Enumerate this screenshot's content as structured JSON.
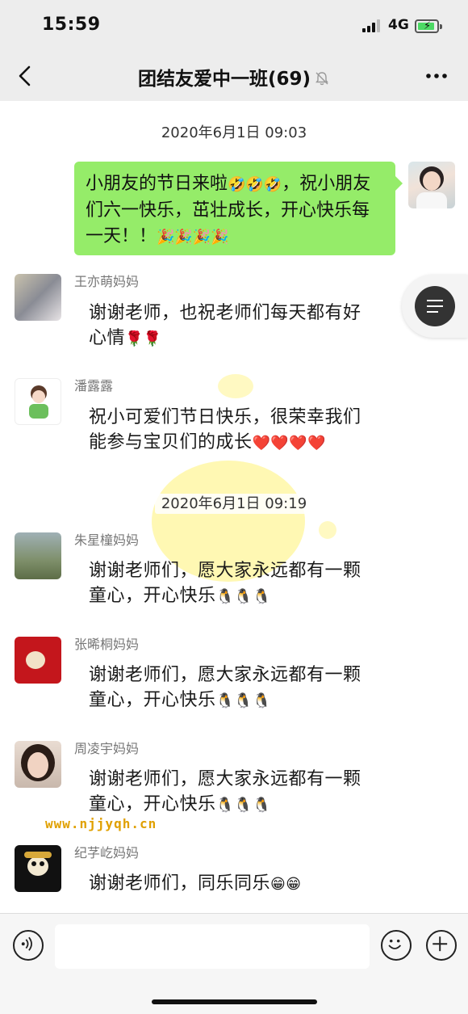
{
  "status_bar": {
    "time": "15:59",
    "network": "4G",
    "battery_icon": "battery-charging-icon"
  },
  "nav": {
    "title": "团结友爱中一班(69)",
    "back_icon": "chevron-left-icon",
    "mute_icon": "bell-muted-icon",
    "more_icon": "ellipsis-icon"
  },
  "chat": {
    "timestamp1": "2020年6月1日 09:03",
    "timestamp2": "2020年6月1日 09:19",
    "outgoing": {
      "text1": "小朋友的节日来啦",
      "text2": "，祝小朋友们六一快乐，茁壮成长，开心快乐每一天！！"
    },
    "messages": [
      {
        "sender": "王亦萌妈妈",
        "line1": "谢谢老师，也祝老师们每天都有好",
        "line2": "心情",
        "emoji": "🌹🌹"
      },
      {
        "sender": "潘露露",
        "line1": "祝小可爱们节日快乐，很荣幸我们",
        "line2": "能参与宝贝们的成长",
        "emoji": "❤️❤️❤️❤️"
      },
      {
        "sender": "朱星橦妈妈",
        "line1": "谢谢老师们，愿大家永远都有一颗",
        "line2": "童心，开心快乐",
        "emoji": "🐧🐧🐧"
      },
      {
        "sender": "张晞桐妈妈",
        "line1": "谢谢老师们，愿大家永远都有一颗",
        "line2": "童心，开心快乐",
        "emoji": "🐧🐧🐧"
      },
      {
        "sender": "周凌宇妈妈",
        "line1": "谢谢老师们，愿大家永远都有一颗",
        "line2": "童心，开心快乐",
        "emoji": "🐧🐧🐧"
      },
      {
        "sender": "纪芓屹妈妈",
        "line1": "谢谢老师们，同乐同乐",
        "line2": "",
        "emoji": "😁😁"
      }
    ],
    "watermark": "www.njjyqh.cn"
  },
  "input_bar": {
    "voice_icon": "voice-icon",
    "emoji_icon": "smiley-icon",
    "plus_icon": "plus-icon"
  },
  "colors": {
    "bubble_out": "#95ec69",
    "bar_bg": "#ededed"
  }
}
